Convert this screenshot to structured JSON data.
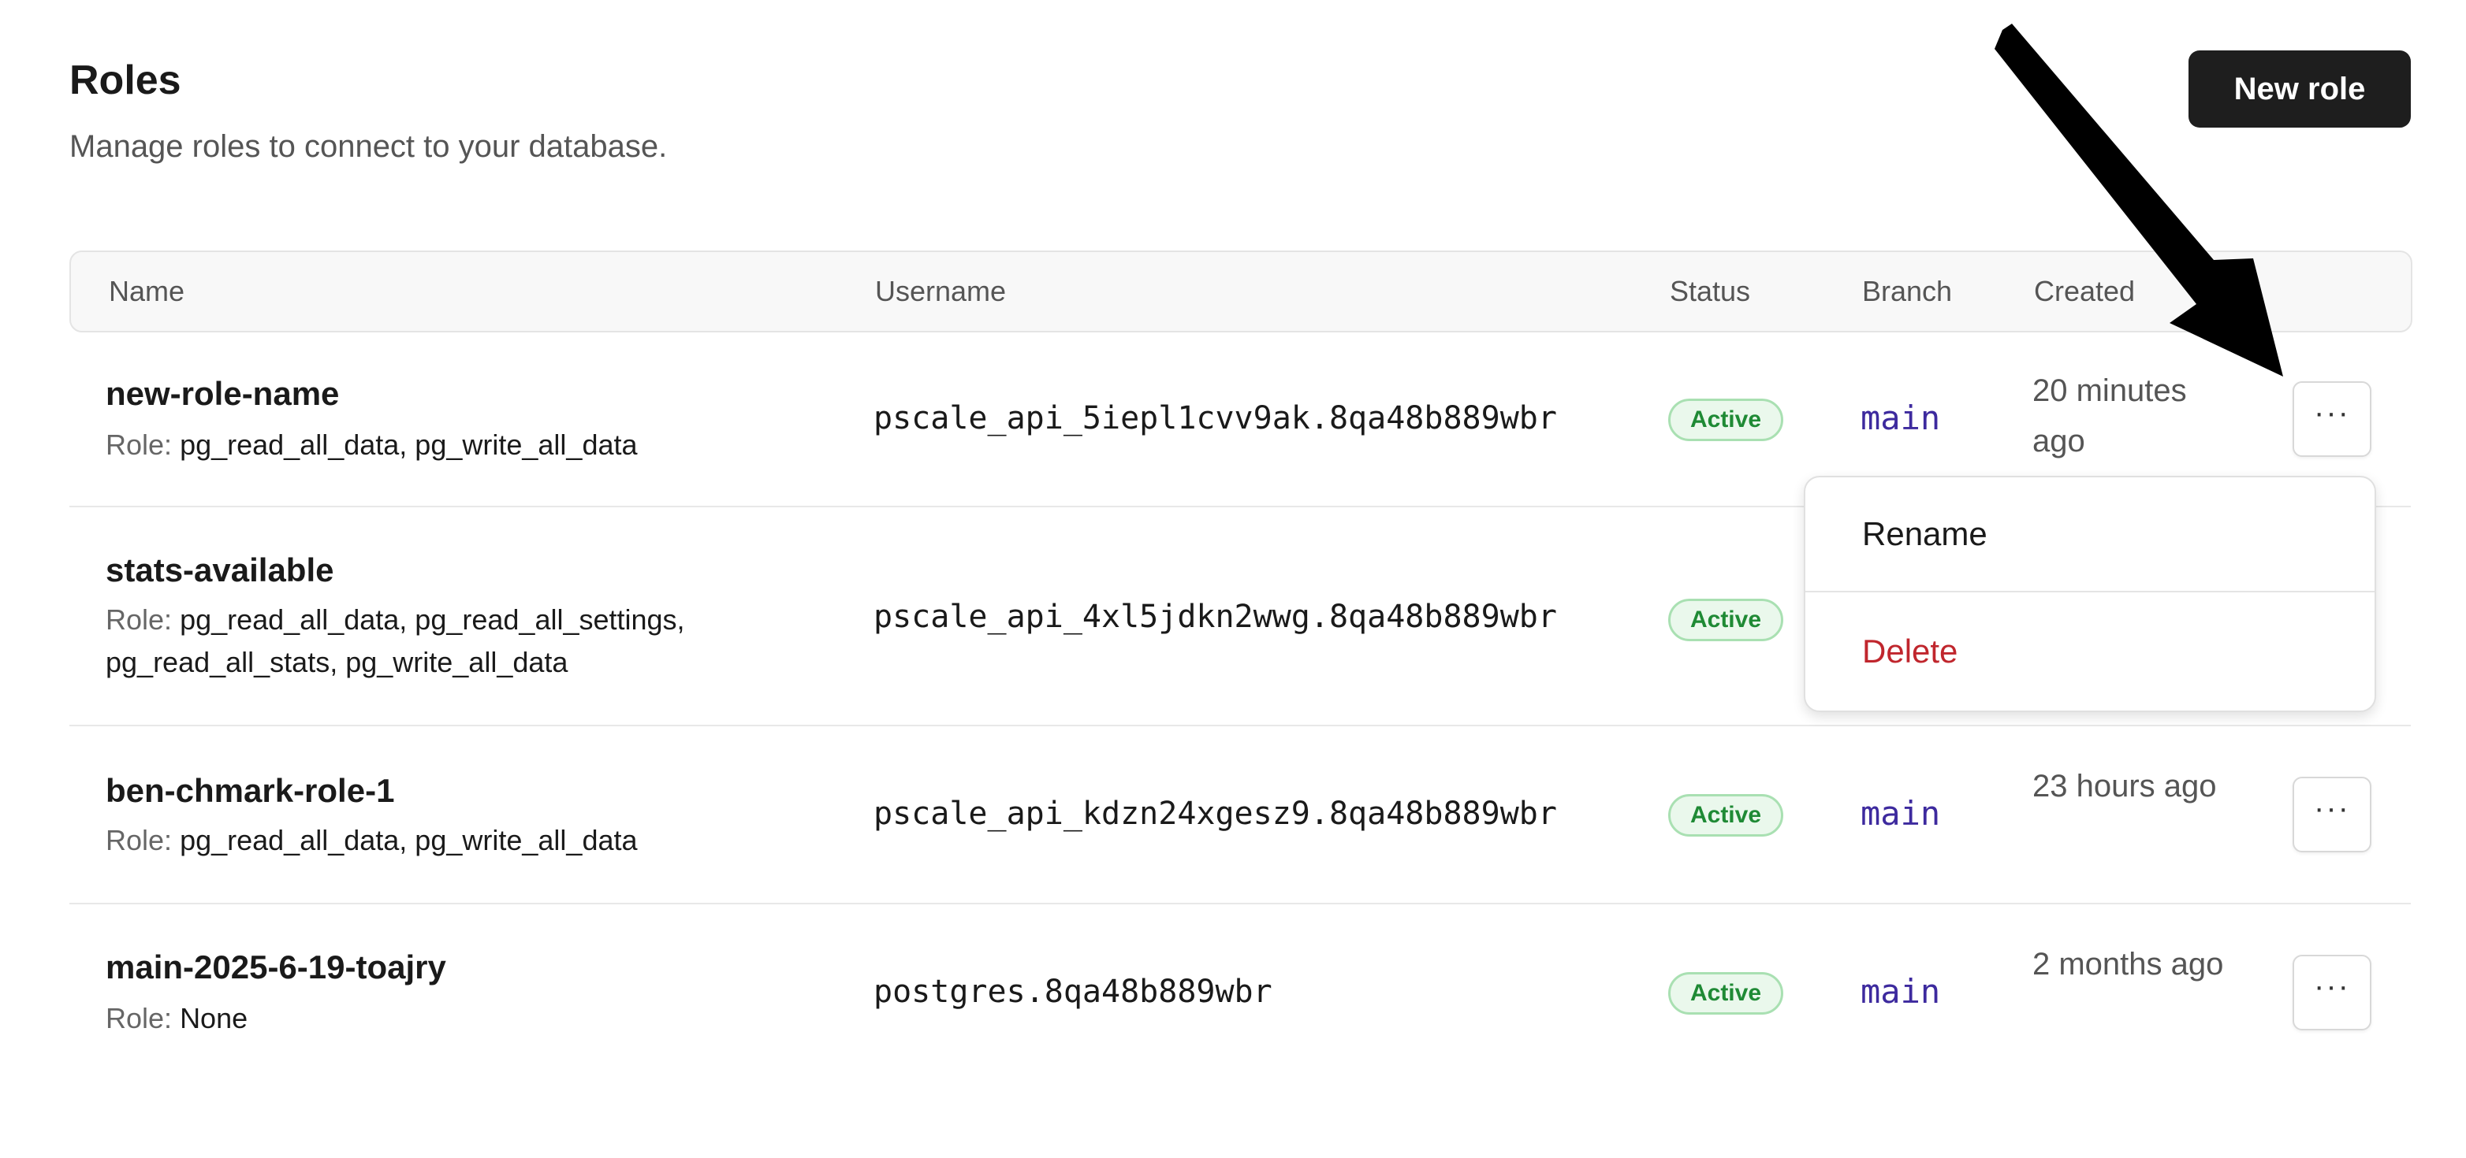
{
  "header": {
    "title": "Roles",
    "subtitle": "Manage roles to connect to your database.",
    "new_role_label": "New role"
  },
  "table": {
    "columns": [
      "Name",
      "Username",
      "Status",
      "Branch",
      "Created"
    ],
    "rows": [
      {
        "name": "new-role-name",
        "role_label": "Role:",
        "roles": "pg_read_all_data, pg_write_all_data",
        "username": "pscale_api_5iepl1cvv9ak.8qa48b889wbr",
        "status": "Active",
        "branch": "main",
        "created": "20 minutes ago"
      },
      {
        "name": "stats-available",
        "role_label": "Role:",
        "roles": "pg_read_all_data, pg_read_all_settings, pg_read_all_stats, pg_write_all_data",
        "username": "pscale_api_4xl5jdkn2wwg.8qa48b889wbr",
        "status": "Active",
        "branch": "",
        "created": ""
      },
      {
        "name": "ben-chmark-role-1",
        "role_label": "Role:",
        "roles": "pg_read_all_data, pg_write_all_data",
        "username": "pscale_api_kdzn24xgesz9.8qa48b889wbr",
        "status": "Active",
        "branch": "main",
        "created": "23 hours ago"
      },
      {
        "name": "main-2025-6-19-toajry",
        "role_label": "Role:",
        "roles": "None",
        "username": "postgres.8qa48b889wbr",
        "status": "Active",
        "branch": "main",
        "created": "2 months ago"
      }
    ],
    "more_icon": "ellipsis-icon",
    "more_glyph": "···"
  },
  "menu": {
    "rename_label": "Rename",
    "delete_label": "Delete"
  },
  "colors": {
    "primary_button": "#1e1e1e",
    "status_active": "#1f8a35",
    "branch_text": "#3d2a9e",
    "danger": "#c0262d"
  }
}
